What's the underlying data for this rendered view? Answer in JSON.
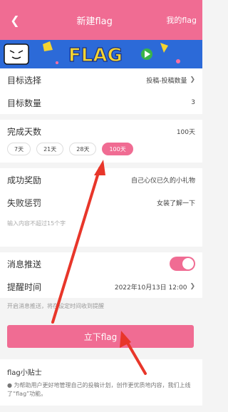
{
  "header": {
    "title": "新建flag",
    "right_link": "我的flag"
  },
  "banner": {
    "text": "FLAG"
  },
  "target": {
    "label": "目标选择",
    "value": "投稿-投稿数量"
  },
  "count": {
    "label": "目标数量",
    "value": "3"
  },
  "days": {
    "label": "完成天数",
    "value": "100天",
    "options": [
      "7天",
      "21天",
      "28天",
      "100天"
    ]
  },
  "reward": {
    "label": "成功奖励",
    "value": "自己心仪已久的小礼物"
  },
  "penalty": {
    "label": "失败惩罚",
    "value": "女装了解一下"
  },
  "input_hint": "输入内容不超过15个字",
  "push": {
    "label": "消息推送",
    "enabled": true
  },
  "remind": {
    "label": "提醒时间",
    "value": "2022年10月13日 12:00"
  },
  "push_note": "开启消息推送，将在设定时间收到提醒",
  "submit_label": "立下flag",
  "tips": {
    "title": "flag小贴士",
    "body": "● 为帮助用户更好地管理自己的投稿计划，创作更优质地内容，我们上线了“flag”功能。"
  },
  "colors": {
    "accent": "#f06c93",
    "banner": "#2c6ad8",
    "arrow": "#e8362a"
  }
}
